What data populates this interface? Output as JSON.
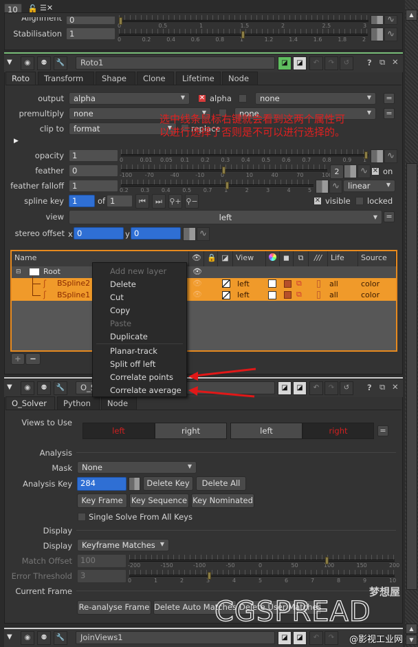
{
  "top_strip": {
    "frame_value": "10",
    "lock_icon": "unlock-icon",
    "clear_icon": "clear-panels-icon"
  },
  "prev_node": {
    "params": [
      {
        "label": "Alignment",
        "value": "0",
        "ticks": [
          "0",
          "0.5",
          "1",
          "1.5",
          "2",
          "2.5",
          "3"
        ],
        "handle_value": 0
      },
      {
        "label": "Stabilisation",
        "value": "1",
        "ticks": [
          "0",
          "0.2",
          "0.4",
          "0.6",
          "0.8",
          "1",
          "1.2",
          "1.4",
          "1.6",
          "1.8",
          "2"
        ],
        "handle_value": 1
      }
    ]
  },
  "roto_node": {
    "name": "Roto1",
    "tabs": [
      "Roto",
      "Transform",
      "Shape",
      "Clone",
      "Lifetime",
      "Node"
    ],
    "active_tab": "Roto",
    "output": {
      "label": "output",
      "value": "alpha",
      "channel_label": "alpha",
      "channel2": "none"
    },
    "premultiply": {
      "label": "premultiply",
      "value": "none",
      "channel2": "none"
    },
    "clip_to": {
      "label": "clip to",
      "value": "format",
      "replace_label": "replace"
    },
    "opacity": {
      "label": "opacity",
      "value": "1",
      "ticks": [
        "0",
        "0.01",
        "0.05",
        "0.1",
        "0.2",
        "0.3",
        "0.4",
        "0.5",
        "0.6",
        "0.7",
        "0.8",
        "0.9",
        "1"
      ]
    },
    "feather": {
      "label": "feather",
      "value": "0",
      "ticks": [
        "-100",
        "-70",
        "-40",
        "-10",
        "0",
        "10",
        "40",
        "70",
        "100"
      ],
      "dims": "2",
      "on_label": "on"
    },
    "feather_falloff": {
      "label": "feather falloff",
      "value": "1",
      "ticks": [
        "0.2",
        "0.3",
        "0.4",
        "0.5",
        "0.7",
        "1",
        "2",
        "3",
        "4",
        "5"
      ],
      "mode": "linear"
    },
    "spline_key": {
      "label": "spline key",
      "value": "1",
      "of_label": "of",
      "total": "1",
      "visible_label": "visible",
      "locked_label": "locked"
    },
    "view": {
      "label": "view",
      "value": "left"
    },
    "stereo_offset": {
      "label": "stereo offset",
      "x_label": "x",
      "x": "0",
      "y_label": "y",
      "y": "0"
    },
    "layer_table": {
      "columns": [
        "Name",
        "eye",
        "lock",
        "invert",
        "View",
        "color",
        "blend",
        "overlay",
        "motion",
        "Life",
        "Source"
      ],
      "rows": [
        {
          "name": "Root",
          "type": "folder",
          "view": "",
          "life": "",
          "source": ""
        },
        {
          "name": "BSpline2",
          "type": "bspline",
          "view": "left",
          "life": "all",
          "source": "color"
        },
        {
          "name": "BSpline1",
          "type": "bspline",
          "view": "left",
          "life": "all",
          "source": "color"
        }
      ],
      "add_label": "+",
      "remove_label": "−"
    }
  },
  "context_menu": {
    "items": [
      {
        "label": "Add new layer",
        "enabled": false
      },
      {
        "label": "Delete",
        "enabled": true
      },
      {
        "label": "Cut",
        "enabled": true
      },
      {
        "label": "Copy",
        "enabled": true
      },
      {
        "label": "Paste",
        "enabled": false
      },
      {
        "label": "Duplicate",
        "enabled": true
      },
      {
        "label": "Planar-track",
        "enabled": true
      },
      {
        "label": "Split off left",
        "enabled": true
      },
      {
        "label": "Correlate points",
        "enabled": true
      },
      {
        "label": "Correlate average",
        "enabled": true
      }
    ]
  },
  "annotation": {
    "line1": "选中线条鼠标右键就会看到这两个属性可",
    "line2": "以进行选择了否则是不可以进行选择的。",
    "color": "#e02020"
  },
  "solver_node": {
    "name": "O_Solver1",
    "name_visible": "O_S",
    "tabs": [
      "O_Solver",
      "Python",
      "Node"
    ],
    "active_tab": "O_Solver",
    "views_to_use": {
      "label": "Views to Use",
      "toggles": [
        {
          "label": "left",
          "active": false
        },
        {
          "label": "right",
          "active": true
        },
        {
          "label": "left",
          "active": true
        },
        {
          "label": "right",
          "active": false
        }
      ]
    },
    "analysis_section": "Analysis",
    "mask": {
      "label": "Mask",
      "value": "None"
    },
    "analysis_key": {
      "label": "Analysis Key",
      "value": "284"
    },
    "buttons_row1": [
      "Delete Key",
      "Delete All"
    ],
    "buttons_row2": [
      "Key Frame",
      "Key Sequence",
      "Key Nominated"
    ],
    "single_solve": {
      "label": "Single Solve From All Keys",
      "checked": false
    },
    "display_section": "Display",
    "display": {
      "label": "Display",
      "value": "Keyframe Matches"
    },
    "match_offset": {
      "label": "Match Offset",
      "value": "100",
      "ticks": [
        "-200",
        "-150",
        "-100",
        "-50",
        "0",
        "50",
        "100",
        "150",
        "200"
      ]
    },
    "error_threshold": {
      "label": "Error Threshold",
      "value": "3",
      "ticks": [
        "0",
        "1",
        "2",
        "3",
        "4",
        "5",
        "6",
        "7",
        "8",
        "9",
        "10"
      ]
    },
    "current_frame_section": "Current Frame",
    "buttons_row3": [
      "Re-analyse Frame",
      "Delete Auto Matches",
      "Delete User Matches"
    ]
  },
  "next_node": {
    "name": "JoinViews1"
  },
  "watermark": {
    "brand": "CGSPREAD",
    "cn": "梦想屋",
    "credit": "@影视工业网"
  }
}
